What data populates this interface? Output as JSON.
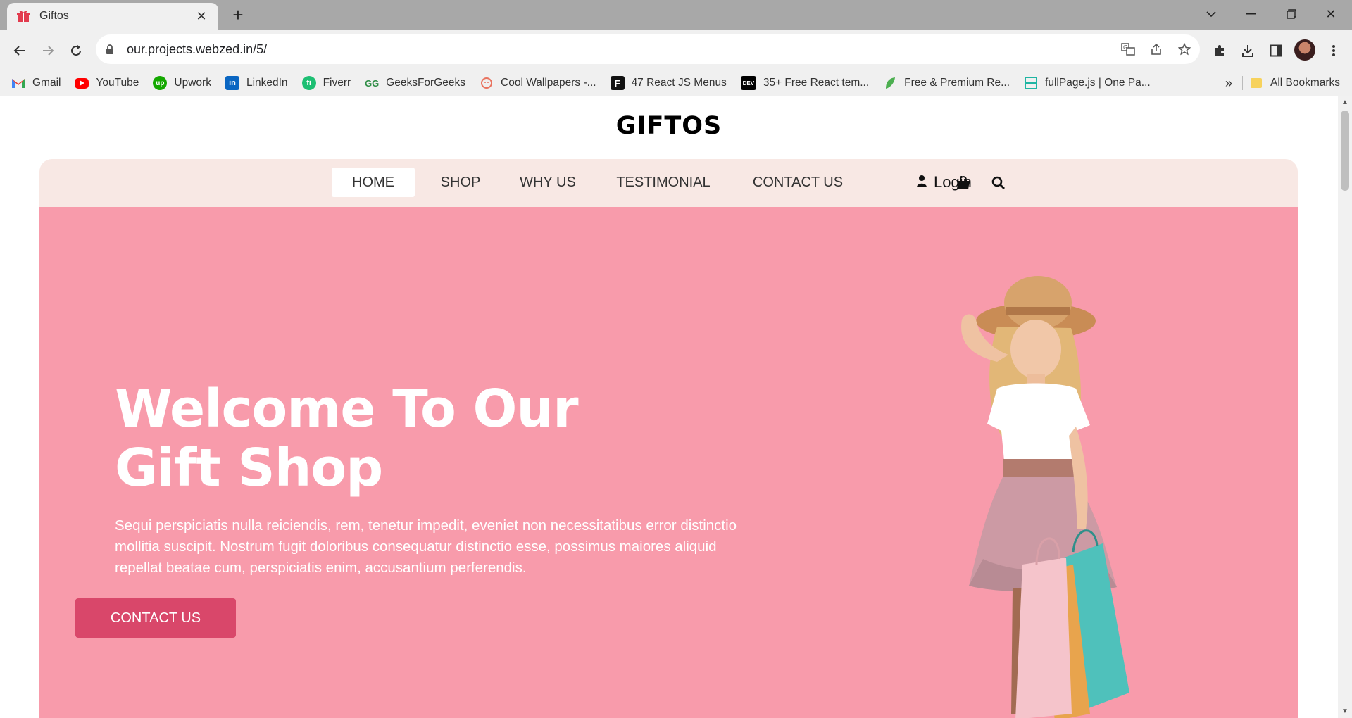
{
  "browser": {
    "tab": {
      "title": "Giftos"
    },
    "url": "our.projects.webzed.in/5/",
    "bookmarks": [
      {
        "label": "Gmail",
        "icon": "gmail-icon",
        "color": "#ea4335"
      },
      {
        "label": "YouTube",
        "icon": "youtube-icon",
        "color": "#ff0000"
      },
      {
        "label": "Upwork",
        "icon": "upwork-icon",
        "color": "#14a800"
      },
      {
        "label": "LinkedIn",
        "icon": "linkedin-icon",
        "color": "#0a66c2"
      },
      {
        "label": "Fiverr",
        "icon": "fiverr-icon",
        "color": "#1dbf73"
      },
      {
        "label": "GeeksForGeeks",
        "icon": "geeksforgeeks-icon",
        "color": "#2f8d46"
      },
      {
        "label": "Cool Wallpapers -...",
        "icon": "wallpapers-icon",
        "color": "#e9735f"
      },
      {
        "label": "47 React JS Menus",
        "icon": "f-icon",
        "color": "#111111"
      },
      {
        "label": "35+ Free React tem...",
        "icon": "dev-icon",
        "color": "#000000"
      },
      {
        "label": "Free & Premium Re...",
        "icon": "leaf-icon",
        "color": "#4caf50"
      },
      {
        "label": "fullPage.js | One Pa...",
        "icon": "fullpage-icon",
        "color": "#1fb5a3"
      }
    ],
    "more_bookmarks": "»",
    "all_bookmarks": "All Bookmarks"
  },
  "page": {
    "brand": "GIFTOS",
    "nav": {
      "items": [
        "HOME",
        "SHOP",
        "WHY US",
        "TESTIMONIAL",
        "CONTACT US"
      ],
      "active": "HOME",
      "login": "Login"
    },
    "hero": {
      "title_line1": "Welcome To Our",
      "title_line2": "Gift Shop",
      "text": "Sequi perspiciatis nulla reiciendis, rem, tenetur impedit, eveniet non necessitatibus error distinctio mollitia suscipit. Nostrum fugit doloribus consequatur distinctio esse, possimus maiores aliquid repellat beatae cum, perspiciatis enim, accusantium perferendis.",
      "button": "CONTACT US"
    },
    "colors": {
      "hero_bg": "#f89bab",
      "nav_bg": "#f8e8e4",
      "button_bg": "#d9476a"
    }
  }
}
